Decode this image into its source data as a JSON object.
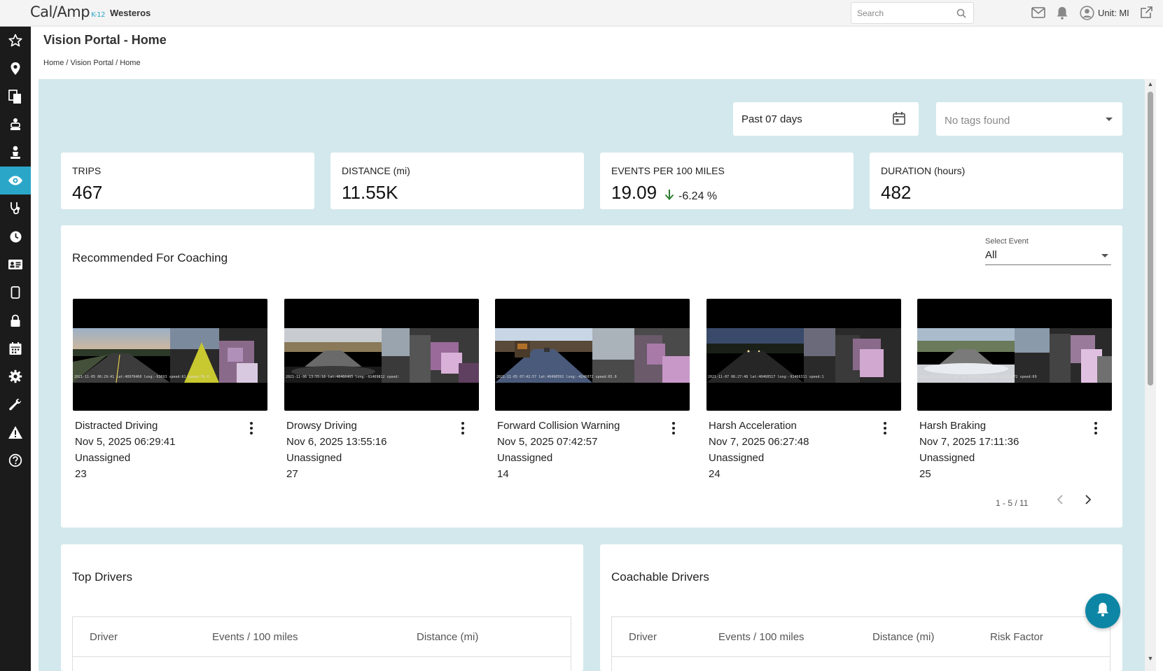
{
  "header": {
    "logo_main": "Cal/Amp",
    "logo_suffix": "K-12",
    "org_name": "Westeros",
    "search_placeholder": "Search",
    "unit_label": "Unit: MI"
  },
  "nav": {
    "items": [
      "star-icon",
      "location-pin-icon",
      "documents-icon",
      "driver-seat-icon",
      "person-icon",
      "eye-icon",
      "stethoscope-icon",
      "clock-icon",
      "id-card-icon",
      "tablet-icon",
      "lock-icon",
      "calendar-icon",
      "gear-icon",
      "wrench-icon",
      "warning-icon",
      "help-icon"
    ],
    "active_item": "eye-icon",
    "accent_color": "#2aa7c8"
  },
  "page": {
    "title": "Vision Portal - Home",
    "breadcrumb": "Home / Vision Portal / Home"
  },
  "filters": {
    "date_range": "Past 07 days",
    "tags_placeholder": "No tags found"
  },
  "stats": [
    {
      "label": "TRIPS",
      "value": "467"
    },
    {
      "label": "DISTANCE (mi)",
      "value": "11.55K"
    },
    {
      "label": "EVENTS PER 100 MILES",
      "value": "19.09",
      "trend": "-6.24 %",
      "trend_direction": "down",
      "trend_color": "#2e7d32"
    },
    {
      "label": "DURATION (hours)",
      "value": "482"
    }
  ],
  "coaching": {
    "title": "Recommended For Coaching",
    "select_label": "Select Event",
    "select_value": "All",
    "events": [
      {
        "type": "Distracted Driving",
        "date": "Nov 5, 2025 06:29:41",
        "assignee": "Unassigned",
        "count": "23",
        "stamp": "2021-11-05 06:29:41  lat:40970460  long:-93693  speed:61  speed:56.6"
      },
      {
        "type": "Drowsy Driving",
        "date": "Nov 6, 2025 13:55:16",
        "assignee": "Unassigned",
        "count": "27",
        "stamp": "2021-11-06 13:55:16  lat:40466405  long:-91469812  speed:"
      },
      {
        "type": "Forward Collision Warning",
        "date": "Nov 5, 2025 07:42:57",
        "assignee": "Unassigned",
        "count": "14",
        "stamp": "2021-11-05 07:42:57  lat:40490591  long:-4246072  speed:65.0"
      },
      {
        "type": "Harsh Acceleration",
        "date": "Nov 7, 2025 06:27:48",
        "assignee": "Unassigned",
        "count": "24",
        "stamp": "2021-11-07 06:27:48  lat:40460517  long:-91466311  speed:1"
      },
      {
        "type": "Harsh Braking",
        "date": "Nov 7, 2025 17:11:36",
        "assignee": "Unassigned",
        "count": "25",
        "stamp": "2021-11-07 17:11:36  lat:40406427  long:-91461872  speed:69"
      }
    ],
    "pagination": "1 - 5 / 11"
  },
  "top_drivers": {
    "title": "Top Drivers",
    "columns": [
      "Driver",
      "Events / 100 miles",
      "Distance (mi)"
    ]
  },
  "coachable_drivers": {
    "title": "Coachable Drivers",
    "columns": [
      "Driver",
      "Events / 100 miles",
      "Distance (mi)",
      "Risk Factor"
    ]
  }
}
